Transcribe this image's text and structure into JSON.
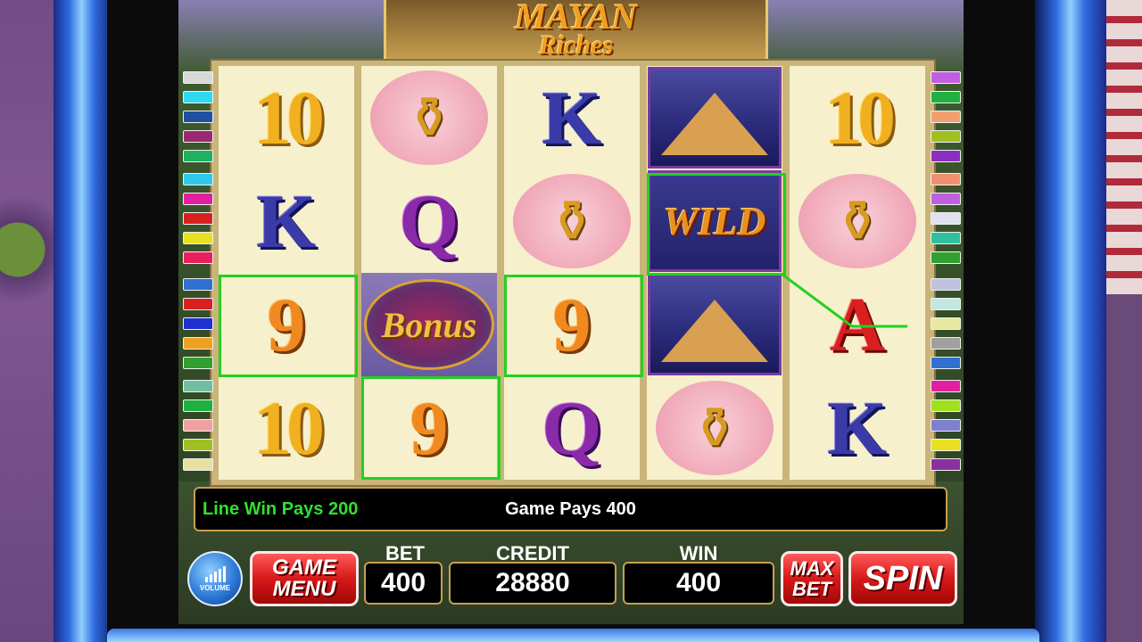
{
  "logo": {
    "title": "MAYAN",
    "subtitle": "Riches"
  },
  "reels": [
    [
      "10",
      "K",
      "9",
      "10"
    ],
    [
      "pot",
      "Q",
      "Bonus",
      "9"
    ],
    [
      "K",
      "pot",
      "9",
      "Q"
    ],
    [
      "temple",
      "WILD",
      "temple",
      "pot"
    ],
    [
      "10",
      "pot",
      "A",
      "K"
    ]
  ],
  "message": {
    "line_win": "Line Win Pays 200",
    "game_pays": "Game Pays 400"
  },
  "controls": {
    "volume_label": "VOLUME",
    "game_menu_label_1": "GAME",
    "game_menu_label_2": "MENU",
    "bet_label": "BET",
    "bet_value": "400",
    "credit_label": "CREDIT",
    "credit_value": "28880",
    "win_label": "WIN",
    "win_value": "400",
    "max_bet_label_1": "MAX",
    "max_bet_label_2": "BET",
    "spin_label": "SPIN"
  },
  "colors": {
    "win_line": "#22d022",
    "accent_red": "#d81818",
    "frame_gold": "#c8a050"
  }
}
